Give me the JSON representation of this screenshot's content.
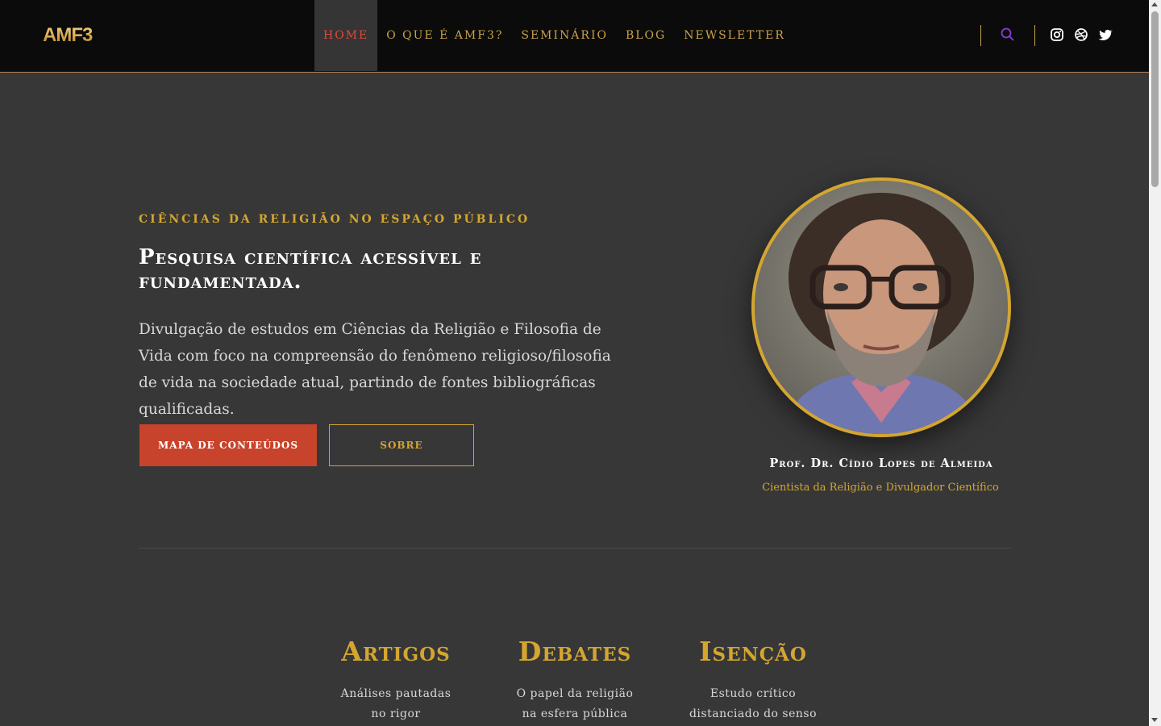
{
  "header": {
    "logo": "AMF3",
    "nav": [
      "HOME",
      "O QUE É AMF3?",
      "SEMINÁRIO",
      "BLOG",
      "NEWSLETTER"
    ],
    "active_index": 0,
    "icons": [
      "search-icon",
      "instagram-icon",
      "dribbble-icon",
      "twitter-icon"
    ]
  },
  "hero": {
    "eyebrow": "CIÊNCIAS DA RELIGIÃO NO ESPAÇO PÚBLICO",
    "headline": "Pesquisa científica acessível e fundamentada.",
    "lead": "Divulgação de estudos em Ciências da Religião e Filosofia de Vida com foco na compreensão do fenômeno religioso/filosofia de vida na sociedade atual, partindo de fontes bibliográficas qualificadas.",
    "primary_button": "MAPA DE CONTEÚDOS",
    "secondary_button": "SOBRE"
  },
  "author": {
    "name": "Prof. Dr. Cídio Lopes de Almeida",
    "role": "Cientista da Religião e Divulgador Científico"
  },
  "features": [
    {
      "title": "Artigos",
      "text": "Análises pautadas no rigor metodológico"
    },
    {
      "title": "Debates",
      "text": "O papel da religião na esfera pública"
    },
    {
      "title": "Isenção",
      "text": "Estudo crítico distanciado do senso"
    }
  ],
  "colors": {
    "accent_gold": "#d4a630",
    "accent_red": "#c8432b",
    "background": "#373737",
    "header_bg": "#0b0b0b"
  }
}
